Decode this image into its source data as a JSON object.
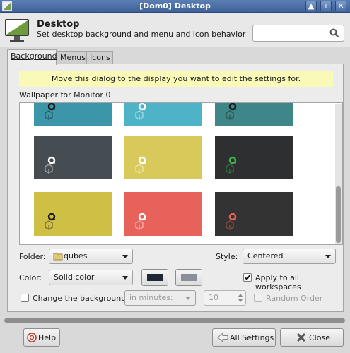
{
  "window": {
    "title": "[Dom0] Desktop"
  },
  "header": {
    "title": "Desktop",
    "subtitle": "Set desktop background and menu and icon behavior",
    "search_placeholder": ""
  },
  "tabs": [
    {
      "label": "Background",
      "active": true
    },
    {
      "label": "Menus",
      "active": false
    },
    {
      "label": "Icons",
      "active": false
    }
  ],
  "background": {
    "notice": "Move this dialog to the display you want to edit the settings for.",
    "wallpaper_label": "Wallpaper for Monitor 0",
    "wallpapers": [
      {
        "color": "#3a96a8",
        "logo": "#1a1a1a"
      },
      {
        "color": "#4fb3c8",
        "logo": "#ffffff"
      },
      {
        "color": "#3f8688",
        "logo": "#1a1a1a"
      },
      {
        "color": "#454c52",
        "logo": "#ffffff"
      },
      {
        "color": "#d9c95a",
        "logo": "#ffffff"
      },
      {
        "color": "#2e2f30",
        "logo": "#3cb44a"
      },
      {
        "color": "#cfbf45",
        "logo": "#1a1a1a"
      },
      {
        "color": "#e7625b",
        "logo": "#ffffff"
      },
      {
        "color": "#333333",
        "logo": "#e7625b"
      }
    ],
    "folder_label": "Folder:",
    "folder_value": "qubes",
    "style_label": "Style:",
    "style_value": "Centered",
    "color_label": "Color:",
    "color_value": "Solid color",
    "primary_color": "#1e2833",
    "secondary_color": "#8a8f9a",
    "apply_all_label": "Apply to all workspaces",
    "apply_all_checked": true,
    "change_bg_label": "Change the background",
    "change_bg_checked": false,
    "interval_unit": "in minutes:",
    "interval_value": "10",
    "random_order_label": "Random Order",
    "random_order_checked": false
  },
  "footer": {
    "help_label": "Help",
    "all_settings_label": "All Settings",
    "close_label": "Close"
  }
}
